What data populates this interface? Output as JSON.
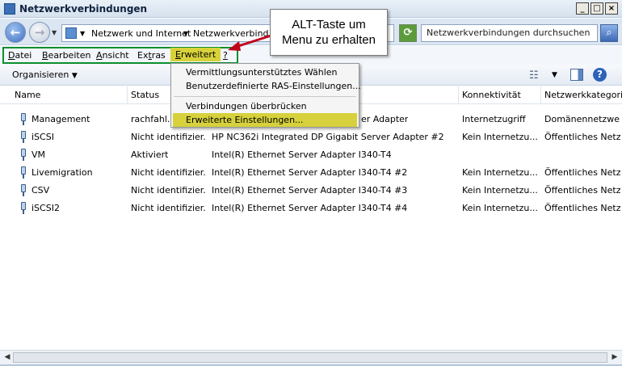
{
  "window": {
    "title": "Netzwerkverbindungen",
    "buttons": [
      "_",
      "□",
      "×"
    ]
  },
  "address": {
    "crumbs": [
      "Netzwerk und Internet",
      "Netzwerkverbind"
    ],
    "search_placeholder": "Netzwerkverbindungen durchsuchen"
  },
  "menu": {
    "datei": {
      "u": "D",
      "rest": "atei"
    },
    "bearbeiten": {
      "u": "B",
      "rest": "earbeiten"
    },
    "ansicht": {
      "u": "A",
      "rest": "nsicht"
    },
    "extras": {
      "u": "",
      "pre": "Ex",
      "mid": "t",
      "post": "ras"
    },
    "erweitert": {
      "u": "E",
      "rest": "rweitert"
    },
    "help": "?"
  },
  "toolbar": {
    "organize": "Organisieren"
  },
  "columns": {
    "name": "Name",
    "status": "Status",
    "device": "",
    "connectivity": "Konnektivität",
    "category": "Netzwerkkategorie"
  },
  "rows": [
    {
      "name": "Management",
      "status": "rachfahl.d",
      "device": "er Adapter",
      "connectivity": "Internetzugriff",
      "category": "Domänennetzwerk"
    },
    {
      "name": "iSCSI",
      "status": "Nicht identifizier...",
      "device": "HP NC362i Integrated DP Gigabit Server Adapter #2",
      "connectivity": "Kein Internetzu...",
      "category": "Öffentliches Netzw"
    },
    {
      "name": "VM",
      "status": "Aktiviert",
      "device": "Intel(R) Ethernet Server Adapter I340-T4",
      "connectivity": "",
      "category": ""
    },
    {
      "name": "Livemigration",
      "status": "Nicht identifizier...",
      "device": "Intel(R) Ethernet Server Adapter I340-T4 #2",
      "connectivity": "Kein Internetzu...",
      "category": "Öffentliches Netzw"
    },
    {
      "name": "CSV",
      "status": "Nicht identifizier...",
      "device": "Intel(R) Ethernet Server Adapter I340-T4 #3",
      "connectivity": "Kein Internetzu...",
      "category": "Öffentliches Netzw"
    },
    {
      "name": "iSCSI2",
      "status": "Nicht identifizier...",
      "device": "Intel(R) Ethernet Server Adapter I340-T4 #4",
      "connectivity": "Kein Internetzu...",
      "category": "Öffentliches Netzw"
    }
  ],
  "dropdown": {
    "items": [
      "Vermittlungsunterstütztes Wählen",
      "Benutzerdefinierte RAS-Einstellungen...",
      "Verbindungen überbrücken",
      "Erweiterte Einstellungen..."
    ]
  },
  "callout": {
    "line1": "ALT-Taste um",
    "line2": "Menu zu erhalten"
  },
  "colors": {
    "menu_highlight": "#d8d23a",
    "menu_box": "#0a8f2f",
    "arrow": "#c0001a"
  },
  "icons": [
    "back-arrow-icon",
    "forward-arrow-icon",
    "network-folder-icon",
    "refresh-icon",
    "search-icon",
    "view-icon",
    "preview-pane-icon",
    "help-icon",
    "network-adapter-icon"
  ]
}
